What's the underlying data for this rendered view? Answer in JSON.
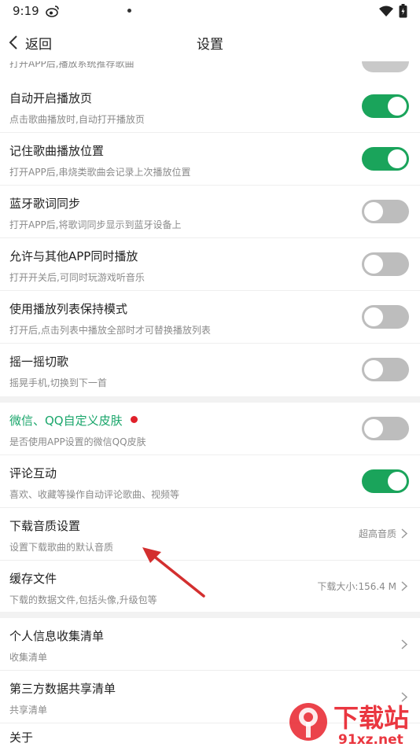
{
  "status_bar": {
    "time": "9:19"
  },
  "header": {
    "back_label": "返回",
    "title": "设置"
  },
  "clipped_top": {
    "subtitle": "打开APP后,播放系统推荐歌曲"
  },
  "settings": [
    {
      "title": "自动开启播放页",
      "subtitle": "点击歌曲播放时,自动打开播放页",
      "toggle": "on"
    },
    {
      "title": "记住歌曲播放位置",
      "subtitle": "打开APP后,串烧类歌曲会记录上次播放位置",
      "toggle": "on"
    },
    {
      "title": "蓝牙歌词同步",
      "subtitle": "打开APP后,将歌词同步显示到蓝牙设备上",
      "toggle": "off"
    },
    {
      "title": "允许与其他APP同时播放",
      "subtitle": "打开开关后,可同时玩游戏听音乐",
      "toggle": "off"
    },
    {
      "title": "使用播放列表保持模式",
      "subtitle": "打开后,点击列表中播放全部时才可替换播放列表",
      "toggle": "off"
    },
    {
      "title": "摇一摇切歌",
      "subtitle": "摇晃手机,切换到下一首",
      "toggle": "off"
    }
  ],
  "settings2": [
    {
      "title": "微信、QQ自定义皮肤",
      "subtitle": "是否使用APP设置的微信QQ皮肤",
      "toggle": "off"
    },
    {
      "title": "评论互动",
      "subtitle": "喜欢、收藏等操作自动评论歌曲、视频等",
      "toggle": "on"
    },
    {
      "title": "下载音质设置",
      "subtitle": "设置下载歌曲的默认音质",
      "value": "超高音质"
    },
    {
      "title": "缓存文件",
      "subtitle": "下载的数据文件,包括头像,升级包等",
      "value": "下载大小:156.4 M"
    }
  ],
  "settings3": [
    {
      "title": "个人信息收集清单",
      "subtitle": "收集清单"
    },
    {
      "title": "第三方数据共享清单",
      "subtitle": "共享清单"
    },
    {
      "title": "关于"
    }
  ],
  "watermark": {
    "text": "下载站",
    "url": "91xz.net"
  },
  "colors": {
    "accent_green": "#1aa45b",
    "title_green": "#1aa66b",
    "red_dot": "#e0202a",
    "annotation_arrow": "#d32f2f"
  }
}
